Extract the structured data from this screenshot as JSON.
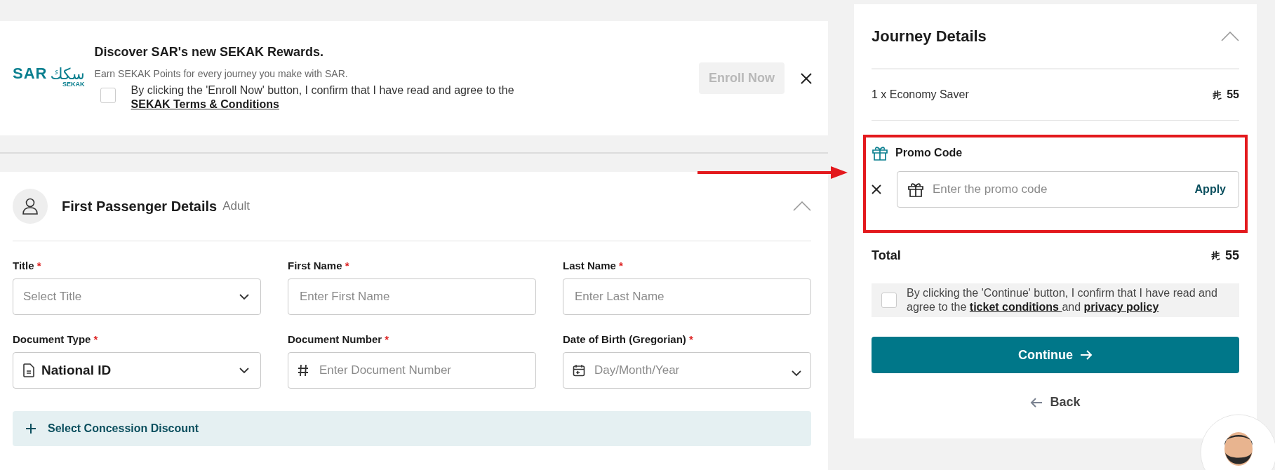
{
  "rewards_banner": {
    "logo": {
      "latin": "SAR",
      "arabic": "سكك",
      "sub": "SEKAK"
    },
    "title": "Discover SAR's new SEKAK Rewards.",
    "subtitle": "Earn SEKAK Points for every journey you make with SAR.",
    "consent": {
      "checked": false,
      "text": "By clicking the 'Enroll Now' button, I confirm that I have read and agree to the ",
      "link": "SEKAK Terms & Conditions"
    },
    "enroll_button": {
      "label": "Enroll Now",
      "disabled": true
    }
  },
  "passenger": {
    "title": "First Passenger Details",
    "type": "Adult",
    "expanded": true,
    "fields": [
      {
        "label": "Title",
        "required_mark": "*",
        "kind": "select",
        "placeholder": "Select Title"
      },
      {
        "label": "First Name",
        "required_mark": "*",
        "kind": "text",
        "placeholder": "Enter First Name"
      },
      {
        "label": "Last Name",
        "required_mark": "*",
        "kind": "text",
        "placeholder": "Enter Last Name"
      },
      {
        "label": "Document Type",
        "required_mark": "*",
        "kind": "doc-select",
        "value": "National ID"
      },
      {
        "label": "Document Number",
        "required_mark": "*",
        "kind": "number",
        "placeholder": "Enter Document Number"
      },
      {
        "label": "Date of Birth (Gregorian)",
        "required_mark": "*",
        "kind": "date",
        "placeholder": "Day/Month/Year"
      }
    ],
    "concession": "Select Concession Discount"
  },
  "journey": {
    "title": "Journey Details",
    "expanded": true,
    "items": [
      {
        "label": "1 x Economy Saver",
        "price": "55"
      }
    ],
    "promo": {
      "title": "Promo Code",
      "placeholder": "Enter the promo code",
      "apply": "Apply",
      "highlighted": true
    },
    "total": {
      "label": "Total",
      "price": "55"
    },
    "consent": {
      "checked": false,
      "text": "By clicking the 'Continue' button, I confirm that I have read and agree to the ",
      "link1": " ticket conditions ",
      "middle": " and ",
      "link2": " privacy policy "
    },
    "continue": "Continue",
    "back": "Back"
  }
}
